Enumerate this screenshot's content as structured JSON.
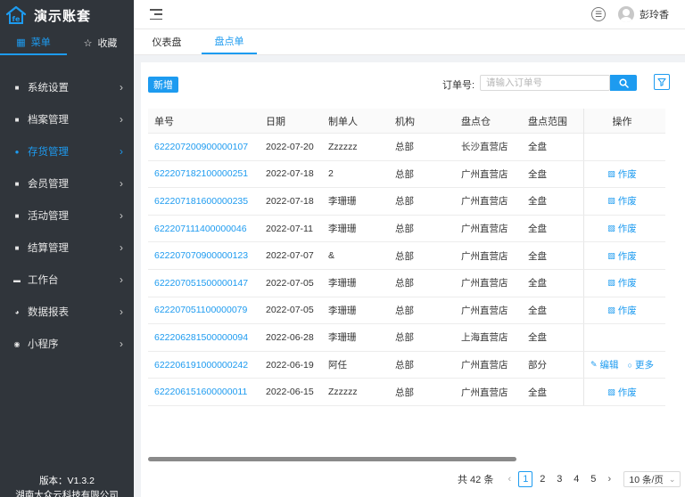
{
  "app": {
    "title": "演示账套",
    "colors": {
      "sidebar_bg": "#30353b",
      "accent": "#1d9bf0"
    }
  },
  "sidebar": {
    "tabs": [
      {
        "label": "菜单",
        "icon": "grid-icon",
        "active": true
      },
      {
        "label": "收藏",
        "icon": "star-icon",
        "active": false
      }
    ],
    "items": [
      {
        "label": "系统设置",
        "icon": "settings-icon"
      },
      {
        "label": "档案管理",
        "icon": "archive-icon"
      },
      {
        "label": "存货管理",
        "icon": "inventory-icon",
        "active": true
      },
      {
        "label": "会员管理",
        "icon": "member-icon"
      },
      {
        "label": "活动管理",
        "icon": "gift-icon"
      },
      {
        "label": "结算管理",
        "icon": "settlement-icon"
      },
      {
        "label": "工作台",
        "icon": "workbench-icon"
      },
      {
        "label": "数据报表",
        "icon": "chart-icon"
      },
      {
        "label": "小程序",
        "icon": "miniapp-icon"
      }
    ],
    "footer": {
      "version": "版本：V1.3.2",
      "company": "湖南大众云科技有限公司"
    }
  },
  "header": {
    "user_name": "彭玲香"
  },
  "page_tabs": [
    {
      "label": "仪表盘",
      "active": false
    },
    {
      "label": "盘点单",
      "active": true
    }
  ],
  "toolbar": {
    "add_label": "新增",
    "order_label": "订单号:",
    "order_placeholder": "请输入订单号"
  },
  "table": {
    "columns": [
      "单号",
      "日期",
      "制单人",
      "机构",
      "盘点仓",
      "盘点范围",
      "操作"
    ],
    "rows": [
      {
        "order": "622207200900000107",
        "date": "2022-07-20",
        "creator": "Zzzzzz",
        "org": "总部",
        "warehouse": "长沙直营店",
        "scope": "全盘",
        "actions": []
      },
      {
        "order": "622207182100000251",
        "date": "2022-07-18",
        "creator": "2",
        "org": "总部",
        "warehouse": "广州直营店",
        "scope": "全盘",
        "actions": [
          "作废"
        ]
      },
      {
        "order": "622207181600000235",
        "date": "2022-07-18",
        "creator": "李珊珊",
        "org": "总部",
        "warehouse": "广州直营店",
        "scope": "全盘",
        "actions": [
          "作废"
        ]
      },
      {
        "order": "622207111400000046",
        "date": "2022-07-11",
        "creator": "李珊珊",
        "org": "总部",
        "warehouse": "广州直营店",
        "scope": "全盘",
        "actions": [
          "作废"
        ]
      },
      {
        "order": "622207070900000123",
        "date": "2022-07-07",
        "creator": "&",
        "org": "总部",
        "warehouse": "广州直营店",
        "scope": "全盘",
        "actions": [
          "作废"
        ]
      },
      {
        "order": "622207051500000147",
        "date": "2022-07-05",
        "creator": "李珊珊",
        "org": "总部",
        "warehouse": "广州直营店",
        "scope": "全盘",
        "actions": [
          "作废"
        ]
      },
      {
        "order": "622207051100000079",
        "date": "2022-07-05",
        "creator": "李珊珊",
        "org": "总部",
        "warehouse": "广州直营店",
        "scope": "全盘",
        "actions": [
          "作废"
        ]
      },
      {
        "order": "622206281500000094",
        "date": "2022-06-28",
        "creator": "李珊珊",
        "org": "总部",
        "warehouse": "上海直营店",
        "scope": "全盘",
        "actions": []
      },
      {
        "order": "622206191000000242",
        "date": "2022-06-19",
        "creator": "阿任",
        "org": "总部",
        "warehouse": "广州直营店",
        "scope": "部分",
        "actions": [
          "编辑",
          "更多"
        ]
      },
      {
        "order": "622206151600000011",
        "date": "2022-06-15",
        "creator": "Zzzzzz",
        "org": "总部",
        "warehouse": "广州直营店",
        "scope": "全盘",
        "actions": [
          "作废"
        ]
      }
    ]
  },
  "pagination": {
    "total": "共 42 条",
    "pages": [
      "1",
      "2",
      "3",
      "4",
      "5"
    ],
    "current": "1",
    "page_size": "10 条/页"
  }
}
